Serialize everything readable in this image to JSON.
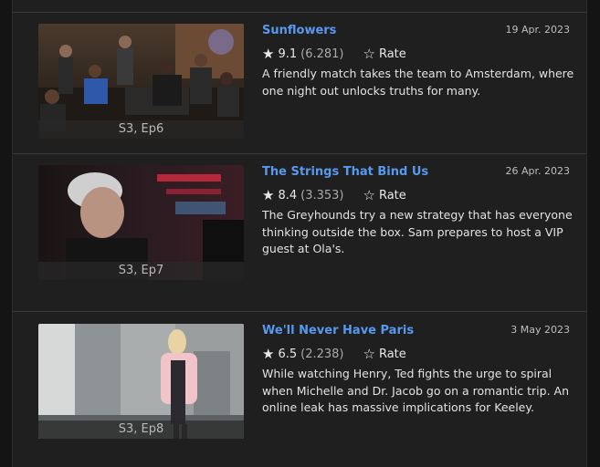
{
  "colors": {
    "background": "#1f1f1f",
    "title_link": "#5799ef",
    "text": "#e2e2e2",
    "muted": "#aaaaaa"
  },
  "episodes": [
    {
      "title": "Sunflowers",
      "date": "19 Apr. 2023",
      "star_icon": "star-filled-icon",
      "rating": "9.1",
      "votes": "(6.281)",
      "rate_icon": "star-outline-icon",
      "rate_label": "Rate",
      "description": "A friendly match takes the team to Amsterdam, where one night out unlocks truths for many.",
      "thumb_label": "S3, Ep6"
    },
    {
      "title": "The Strings That Bind Us",
      "date": "26 Apr. 2023",
      "star_icon": "star-filled-icon",
      "rating": "8.4",
      "votes": "(3.353)",
      "rate_icon": "star-outline-icon",
      "rate_label": "Rate",
      "description": "The Greyhounds try a new strategy that has everyone thinking outside the box. Sam prepares to host a VIP guest at Ola's.",
      "thumb_label": "S3, Ep7"
    },
    {
      "title": "We'll Never Have Paris",
      "date": "3 May 2023",
      "star_icon": "star-filled-icon",
      "rating": "6.5",
      "votes": "(2.238)",
      "rate_icon": "star-outline-icon",
      "rate_label": "Rate",
      "description": "While watching Henry, Ted fights the urge to spiral when Michelle and Dr. Jacob go on a romantic trip. An online leak has massive implications for Keeley.",
      "thumb_label": "S3, Ep8"
    }
  ]
}
